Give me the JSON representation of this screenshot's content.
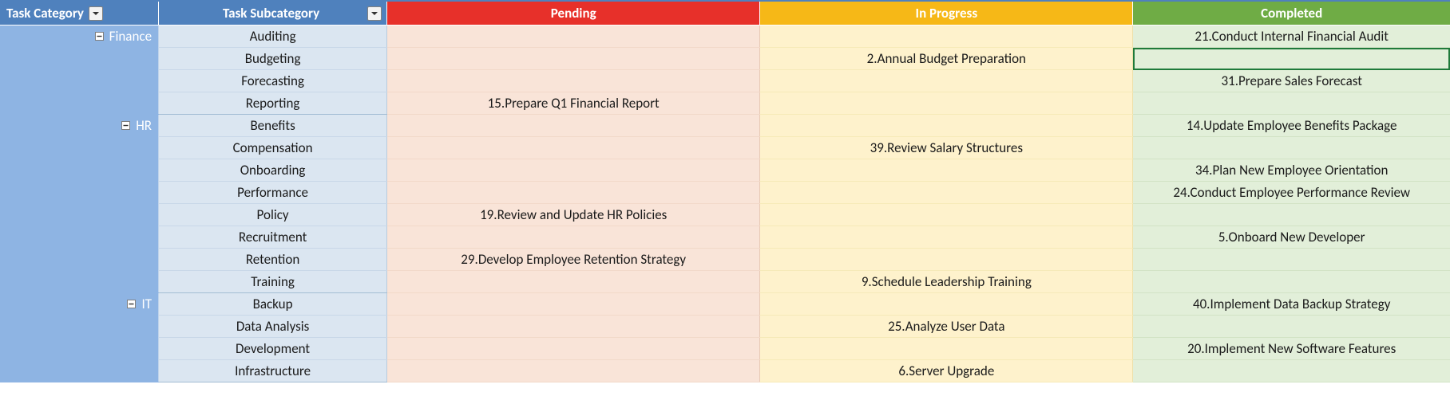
{
  "headers": {
    "category": "Task Category",
    "subcategory": "Task Subcategory",
    "pending": "Pending",
    "in_progress": "In Progress",
    "completed": "Completed"
  },
  "groups": [
    {
      "name": "Finance",
      "rows": [
        {
          "sub": "Auditing",
          "pending": "",
          "in_progress": "",
          "completed": "21.Conduct Internal Financial Audit",
          "selected": false
        },
        {
          "sub": "Budgeting",
          "pending": "",
          "in_progress": "2.Annual Budget Preparation",
          "completed": "",
          "selected": true
        },
        {
          "sub": "Forecasting",
          "pending": "",
          "in_progress": "",
          "completed": "31.Prepare Sales Forecast",
          "selected": false
        },
        {
          "sub": "Reporting",
          "pending": "15.Prepare Q1 Financial Report",
          "in_progress": "",
          "completed": "",
          "selected": false
        }
      ]
    },
    {
      "name": "HR",
      "rows": [
        {
          "sub": "Benefits",
          "pending": "",
          "in_progress": "",
          "completed": "14.Update Employee Benefits Package",
          "selected": false
        },
        {
          "sub": "Compensation",
          "pending": "",
          "in_progress": "39.Review Salary Structures",
          "completed": "",
          "selected": false
        },
        {
          "sub": "Onboarding",
          "pending": "",
          "in_progress": "",
          "completed": "34.Plan New Employee Orientation",
          "selected": false
        },
        {
          "sub": "Performance",
          "pending": "",
          "in_progress": "",
          "completed": "24.Conduct Employee Performance Review",
          "selected": false
        },
        {
          "sub": "Policy",
          "pending": "19.Review and Update HR Policies",
          "in_progress": "",
          "completed": "",
          "selected": false
        },
        {
          "sub": "Recruitment",
          "pending": "",
          "in_progress": "",
          "completed": "5.Onboard New Developer",
          "selected": false
        },
        {
          "sub": "Retention",
          "pending": "29.Develop Employee Retention Strategy",
          "in_progress": "",
          "completed": "",
          "selected": false
        },
        {
          "sub": "Training",
          "pending": "",
          "in_progress": "9.Schedule Leadership Training",
          "completed": "",
          "selected": false
        }
      ]
    },
    {
      "name": "IT",
      "rows": [
        {
          "sub": "Backup",
          "pending": "",
          "in_progress": "",
          "completed": "40.Implement Data Backup Strategy",
          "selected": false
        },
        {
          "sub": "Data Analysis",
          "pending": "",
          "in_progress": "25.Analyze User Data",
          "completed": "",
          "selected": false
        },
        {
          "sub": "Development",
          "pending": "",
          "in_progress": "",
          "completed": "20.Implement New Software Features",
          "selected": false
        },
        {
          "sub": "Infrastructure",
          "pending": "",
          "in_progress": "6.Server Upgrade",
          "completed": "",
          "selected": false
        }
      ]
    }
  ],
  "chart_data": {
    "type": "table",
    "title": "Task status pivot by Category / Subcategory",
    "columns": [
      "Task Category",
      "Task Subcategory",
      "Pending",
      "In Progress",
      "Completed"
    ],
    "rows": [
      [
        "Finance",
        "Auditing",
        "",
        "",
        "21.Conduct Internal Financial Audit"
      ],
      [
        "Finance",
        "Budgeting",
        "",
        "2.Annual Budget Preparation",
        ""
      ],
      [
        "Finance",
        "Forecasting",
        "",
        "",
        "31.Prepare Sales Forecast"
      ],
      [
        "Finance",
        "Reporting",
        "15.Prepare Q1 Financial Report",
        "",
        ""
      ],
      [
        "HR",
        "Benefits",
        "",
        "",
        "14.Update Employee Benefits Package"
      ],
      [
        "HR",
        "Compensation",
        "",
        "39.Review Salary Structures",
        ""
      ],
      [
        "HR",
        "Onboarding",
        "",
        "",
        "34.Plan New Employee Orientation"
      ],
      [
        "HR",
        "Performance",
        "",
        "",
        "24.Conduct Employee Performance Review"
      ],
      [
        "HR",
        "Policy",
        "19.Review and Update HR Policies",
        "",
        ""
      ],
      [
        "HR",
        "Recruitment",
        "",
        "",
        "5.Onboard New Developer"
      ],
      [
        "HR",
        "Retention",
        "29.Develop Employee Retention Strategy",
        "",
        ""
      ],
      [
        "HR",
        "Training",
        "",
        "9.Schedule Leadership Training",
        ""
      ],
      [
        "IT",
        "Backup",
        "",
        "",
        "40.Implement Data Backup Strategy"
      ],
      [
        "IT",
        "Data Analysis",
        "",
        "25.Analyze User Data",
        ""
      ],
      [
        "IT",
        "Development",
        "",
        "",
        "20.Implement New Software Features"
      ],
      [
        "IT",
        "Infrastructure",
        "",
        "6.Server Upgrade",
        ""
      ]
    ]
  }
}
